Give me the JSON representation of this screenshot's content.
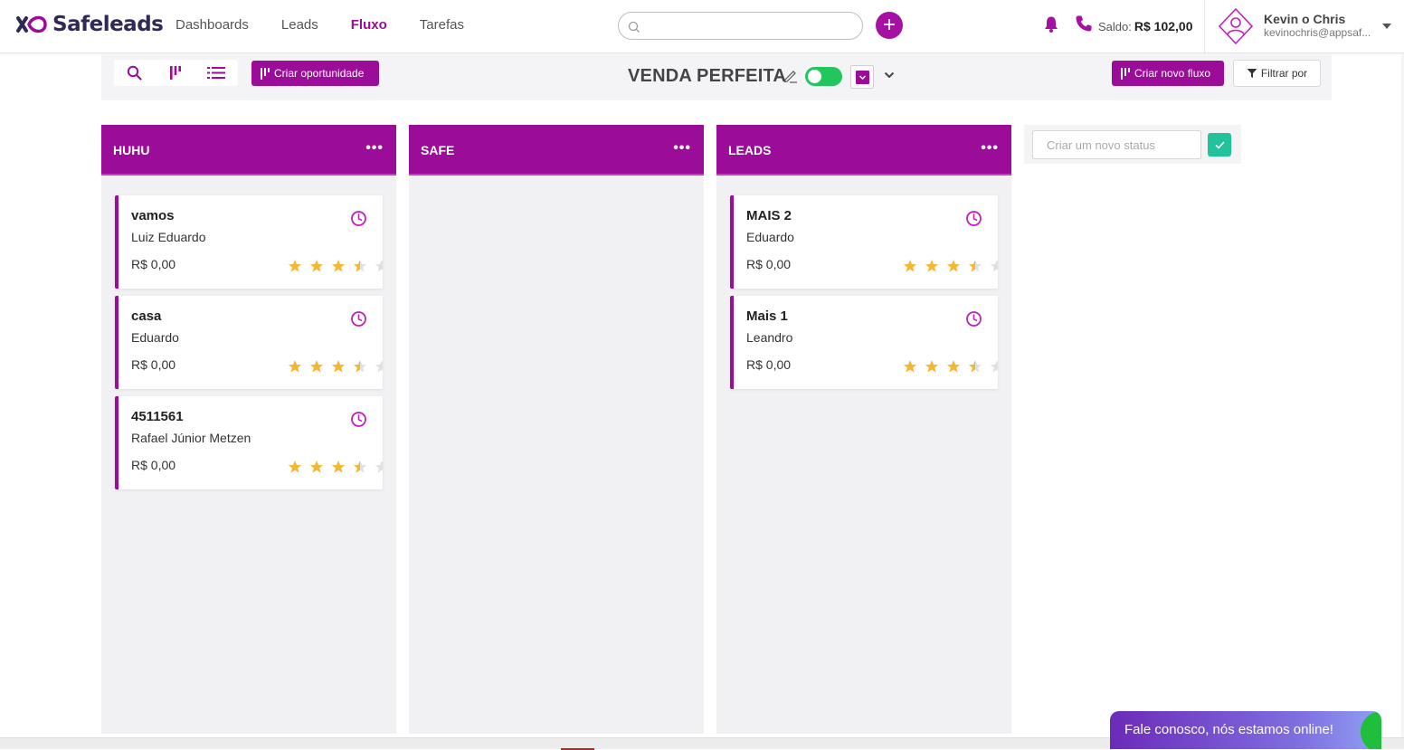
{
  "brand": {
    "name": "Safeleads",
    "accent": "#9b0c98"
  },
  "nav": {
    "items": [
      "Dashboards",
      "Leads",
      "Fluxo",
      "Tarefas"
    ],
    "active": "Fluxo"
  },
  "header": {
    "search_placeholder": "",
    "saldo_label": "Saldo:",
    "saldo_value": "R$ 102,00",
    "user_name": "Kevin o Chris",
    "user_email": "kevinochris@appsaf..."
  },
  "toolbar": {
    "create_opportunity": "Criar oportunidade",
    "flow_title": "VENDA PERFEITA",
    "create_flow": "Criar novo fluxo",
    "filter": "Filtrar por",
    "toggle_on": true
  },
  "columns": [
    {
      "title": "HUHU",
      "menu": "•••",
      "cards": [
        {
          "title": "vamos",
          "contact": "Luiz Eduardo",
          "value": "R$ 0,00",
          "rating": 3.5
        },
        {
          "title": "casa",
          "contact": "Eduardo",
          "value": "R$ 0,00",
          "rating": 3.5
        },
        {
          "title": "4511561",
          "contact": "Rafael Júnior Metzen",
          "value": "R$ 0,00",
          "rating": 3.5
        }
      ]
    },
    {
      "title": "SAFE",
      "menu": "•••",
      "cards": []
    },
    {
      "title": "LEADS",
      "menu": "•••",
      "cards": [
        {
          "title": "MAIS 2",
          "contact": "Eduardo",
          "value": "R$ 0,00",
          "rating": 3.5
        },
        {
          "title": "Mais 1",
          "contact": "Leandro",
          "value": "R$ 0,00",
          "rating": 3.5
        }
      ]
    }
  ],
  "new_status": {
    "placeholder": "Criar um novo status"
  },
  "chat": {
    "label": "Fale conosco, nós estamos online!"
  },
  "icons": {
    "search": "search-icon",
    "kanban": "kanban-icon",
    "list": "list-icon",
    "bell": "bell-icon",
    "phone": "phone-icon",
    "clock": "clock-icon",
    "star": "star-icon",
    "pencil": "pencil-icon",
    "check": "check-icon",
    "filter": "filter-icon"
  },
  "colors": {
    "star": "#f5b731",
    "star_empty": "#e0e0e0",
    "status_ok": "#22c29b",
    "toggle": "#22c55e"
  }
}
